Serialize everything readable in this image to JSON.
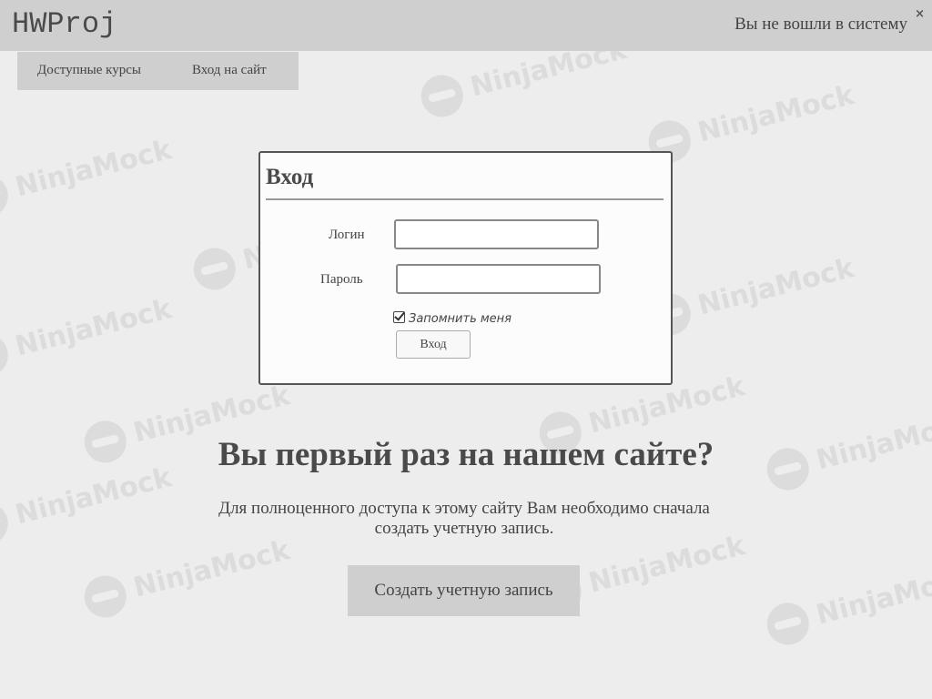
{
  "header": {
    "brand": "HWProj",
    "login_status": "Вы не вошли в систему",
    "close_icon": "×"
  },
  "nav": {
    "items": [
      {
        "label": "Доступные курсы"
      },
      {
        "label": "Вход на сайт"
      }
    ]
  },
  "login_form": {
    "title": "Вход",
    "login_label": "Логин",
    "login_value": "",
    "password_label": "Пароль",
    "password_value": "",
    "remember_label": "Запомнить меня",
    "remember_checked": true,
    "submit_label": "Вход"
  },
  "promo": {
    "title": "Вы первый раз на нашем сайте?",
    "text_line1": "Для полноценного доступа к этому сайту Вам необходимо сначала",
    "text_line2": "создать учетную запись.",
    "button_label": "Создать учетную запись"
  },
  "watermark": {
    "text": "NinjaMock"
  },
  "colors": {
    "background": "#ededed",
    "bar": "#cfcfcf",
    "text": "#444444"
  }
}
